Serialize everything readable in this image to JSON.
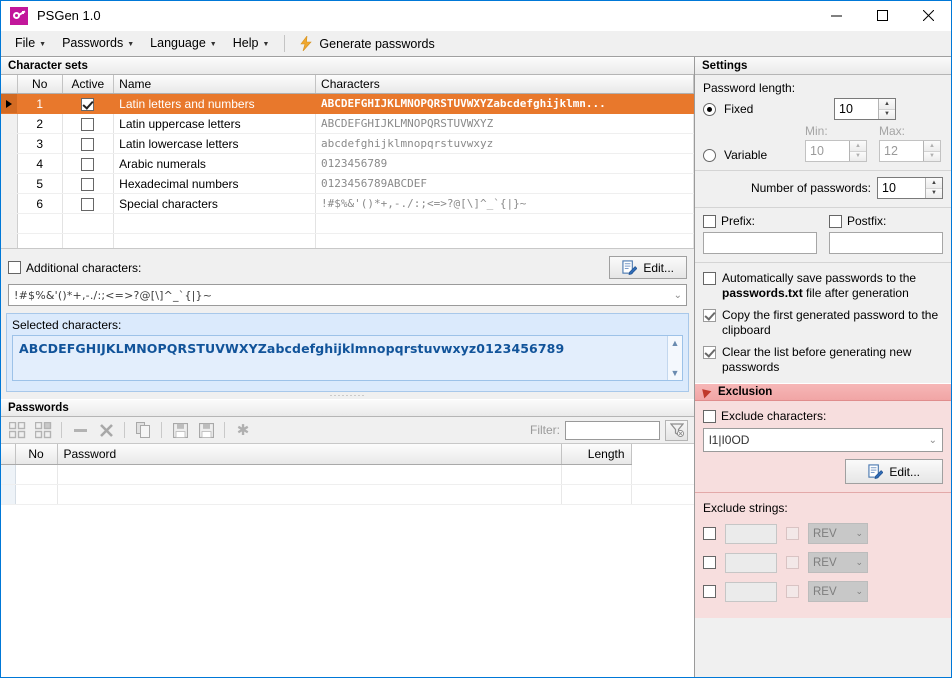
{
  "window": {
    "title": "PSGen 1.0",
    "app_icon": "key-icon",
    "minimize": "minimize-icon",
    "maximize": "maximize-icon",
    "close": "close-icon"
  },
  "menubar": {
    "items": [
      {
        "label": "File"
      },
      {
        "label": "Passwords"
      },
      {
        "label": "Language"
      },
      {
        "label": "Help"
      }
    ],
    "generate_button": {
      "label": "Generate passwords",
      "icon": "lightning-bolt-icon"
    }
  },
  "charsets": {
    "group_title": "Character sets",
    "columns": [
      "No",
      "Active",
      "Name",
      "Characters"
    ],
    "rows": [
      {
        "no": "1",
        "active": true,
        "name": "Latin letters and numbers",
        "chars": "ABCDEFGHIJKLMNOPQRSTUVWXYZabcdefghijklmn...",
        "selected": true
      },
      {
        "no": "2",
        "active": false,
        "name": "Latin uppercase letters",
        "chars": "ABCDEFGHIJKLMNOPQRSTUVWXYZ",
        "selected": false
      },
      {
        "no": "3",
        "active": false,
        "name": "Latin lowercase letters",
        "chars": "abcdefghijklmnopqrstuvwxyz",
        "selected": false
      },
      {
        "no": "4",
        "active": false,
        "name": "Arabic numerals",
        "chars": "0123456789",
        "selected": false
      },
      {
        "no": "5",
        "active": false,
        "name": "Hexadecimal numbers",
        "chars": "0123456789ABCDEF",
        "selected": false
      },
      {
        "no": "6",
        "active": false,
        "name": "Special characters",
        "chars": "!#$%&'()*+,-./:;<=>?@[\\]^_`{|}~",
        "selected": false
      }
    ]
  },
  "additional": {
    "checkbox_label": "Additional characters:",
    "checked": false,
    "edit_label": "Edit...",
    "edit_icon": "edit-document-icon",
    "value": "!#$%&'()*+,-./:;<=>?@[\\]^_`{|}~"
  },
  "selected_characters": {
    "label": "Selected characters:",
    "value": "ABCDEFGHIJKLMNOPQRSTUVWXYZabcdefghijklmnopqrstuvwxyz0123456789"
  },
  "passwords": {
    "group_title": "Passwords",
    "toolbar": [
      {
        "name": "select-all-icon"
      },
      {
        "name": "deselect-all-icon"
      },
      {
        "name": "remove-icon"
      },
      {
        "name": "delete-icon"
      },
      {
        "name": "copy-icon"
      },
      {
        "name": "save-icon"
      },
      {
        "name": "save-as-icon"
      },
      {
        "name": "asterisk-icon"
      }
    ],
    "filter_label": "Filter:",
    "filter_value": "",
    "filter_clear_icon": "clear-filter-icon",
    "columns": [
      "No",
      "Password",
      "Length"
    ],
    "rows": []
  },
  "settings": {
    "group_title": "Settings",
    "password_length_label": "Password length:",
    "fixed": {
      "label": "Fixed",
      "selected": true,
      "value": "10"
    },
    "variable": {
      "label": "Variable",
      "selected": false
    },
    "min_label": "Min:",
    "min_value": "10",
    "max_label": "Max:",
    "max_value": "12",
    "number_of_passwords_label": "Number of passwords:",
    "number_of_passwords_value": "10",
    "prefix": {
      "label": "Prefix:",
      "checked": false,
      "value": ""
    },
    "postfix": {
      "label": "Postfix:",
      "checked": false,
      "value": ""
    },
    "options": [
      {
        "text_before": "Automatically save passwords to the ",
        "bold": "passwords.txt",
        "text_after": " file after generation",
        "checked": false
      },
      {
        "text_before": "Copy the first generated password to the clipboard",
        "bold": "",
        "text_after": "",
        "checked": true
      },
      {
        "text_before": "Clear the list before generating new passwords",
        "bold": "",
        "text_after": "",
        "checked": true
      }
    ]
  },
  "exclusion": {
    "group_title": "Exclusion",
    "exclude_characters_label": "Exclude characters:",
    "exclude_characters_checked": false,
    "exclude_characters_value": "l1|I0OD",
    "edit_label": "Edit...",
    "edit_icon": "edit-document-icon",
    "exclude_strings_label": "Exclude strings:",
    "string_rows": [
      {
        "checked": false,
        "value": "",
        "rev_checked": false,
        "rev_label": "REV"
      },
      {
        "checked": false,
        "value": "",
        "rev_checked": false,
        "rev_label": "REV"
      },
      {
        "checked": false,
        "value": "",
        "rev_checked": false,
        "rev_label": "REV"
      }
    ]
  },
  "colors": {
    "accent": "#0078d7",
    "selected_row": "#e8782c",
    "exclusion_header": "#f1a5a5",
    "exclusion_body": "#f7dede",
    "selected_chars_text": "#12549a",
    "app_icon": "#c2179b"
  }
}
